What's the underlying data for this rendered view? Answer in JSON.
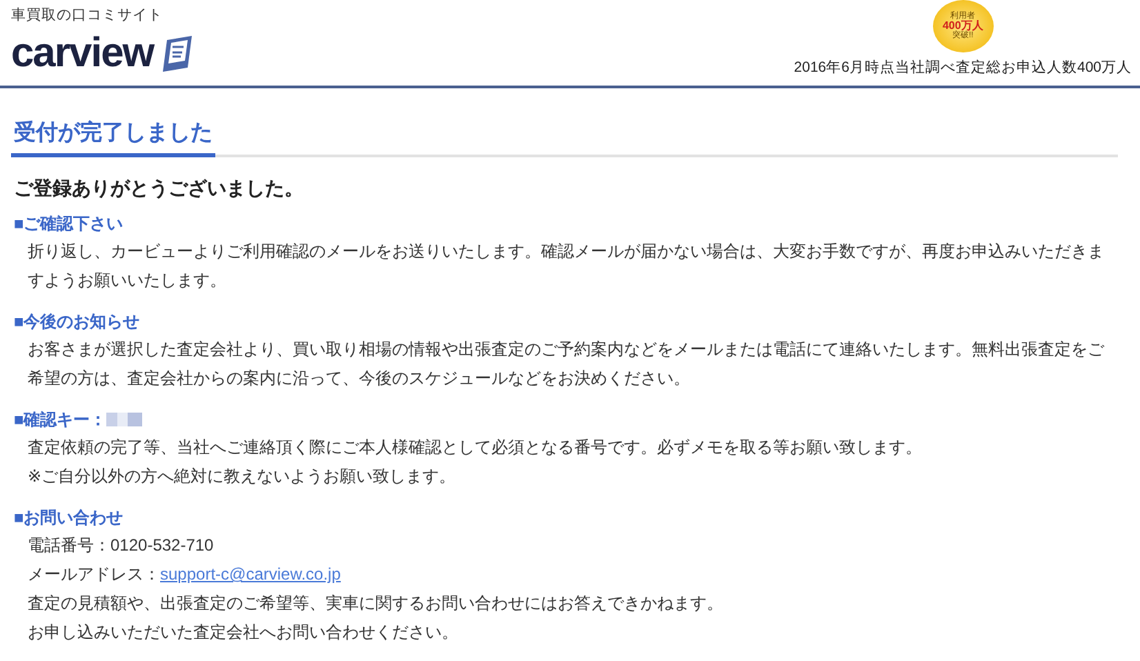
{
  "header": {
    "tagline": "車買取の口コミサイト",
    "logo": "carview",
    "badge": {
      "top": "利用者",
      "middle": "400万人",
      "bottom": "突破!!"
    },
    "note": "2016年6月時点当社調べ査定総お申込人数400万人"
  },
  "page_title": "受付が完了しました",
  "thanks": "ご登録ありがとうございました。",
  "sections": [
    {
      "marker": "■",
      "heading": "ご確認下さい",
      "redacted": false,
      "lines": [
        {
          "text": "折り返し、カービューよりご利用確認のメールをお送りいたします。確認メールが届かない場合は、大変お手数ですが、再度お申込みいただきますようお願いいたします。"
        }
      ]
    },
    {
      "marker": "■",
      "heading": "今後のお知らせ",
      "redacted": false,
      "lines": [
        {
          "text": "お客さまが選択した査定会社より、買い取り相場の情報や出張査定のご予約案内などをメールまたは電話にて連絡いたします。無料出張査定をご希望の方は、査定会社からの案内に沿って、今後のスケジュールなどをお決めください。"
        }
      ]
    },
    {
      "marker": "■",
      "heading": "確認キー：",
      "redacted": true,
      "lines": [
        {
          "text": "査定依頼の完了等、当社へご連絡頂く際にご本人様確認として必須となる番号です。必ずメモを取る等お願い致します。"
        },
        {
          "text": "※ご自分以外の方へ絶対に教えないようお願い致します。"
        }
      ]
    },
    {
      "marker": "■",
      "heading": "お問い合わせ",
      "redacted": false,
      "lines": [
        {
          "text": "電話番号：0120-532-710"
        },
        {
          "text": "メールアドレス：",
          "link": "support-c@carview.co.jp"
        },
        {
          "text": "査定の見積額や、出張査定のご希望等、実車に関するお問い合わせにはお答えできかねます。"
        },
        {
          "text": "お申し込みいただいた査定会社へお問い合わせください。"
        }
      ]
    }
  ]
}
